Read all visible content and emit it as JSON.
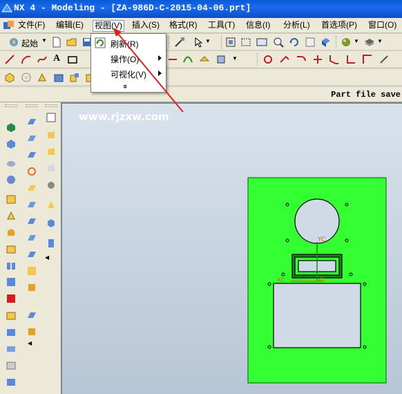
{
  "window": {
    "title": "NX 4 - Modeling - [ZA-986D-C-2015-04-06.prt]"
  },
  "menubar": {
    "items": [
      {
        "label": "文件(F)"
      },
      {
        "label": "编辑(E)"
      },
      {
        "label": "视图(V)"
      },
      {
        "label": "插入(S)"
      },
      {
        "label": "格式(R)"
      },
      {
        "label": "工具(T)"
      },
      {
        "label": "信息(I)"
      },
      {
        "label": "分析(L)"
      },
      {
        "label": "首选项(P)"
      },
      {
        "label": "窗口(O)"
      }
    ]
  },
  "toolbar": {
    "start_label": "起始"
  },
  "view_menu": {
    "items": [
      {
        "label": "刷新(R)",
        "icon": "refresh-icon"
      },
      {
        "label": "操作(O)",
        "icon": "",
        "submenu": true
      },
      {
        "label": "可视化(V)",
        "icon": "",
        "submenu": true
      }
    ],
    "expand_glyph": "»"
  },
  "statusline": {
    "text": "Part file save"
  },
  "viewport": {
    "watermark": "www.rjzxw.com",
    "part_color": "#33ff33",
    "axis_labels": {
      "yc": "YC",
      "xc": "XC",
      "zc": "ZC"
    }
  }
}
